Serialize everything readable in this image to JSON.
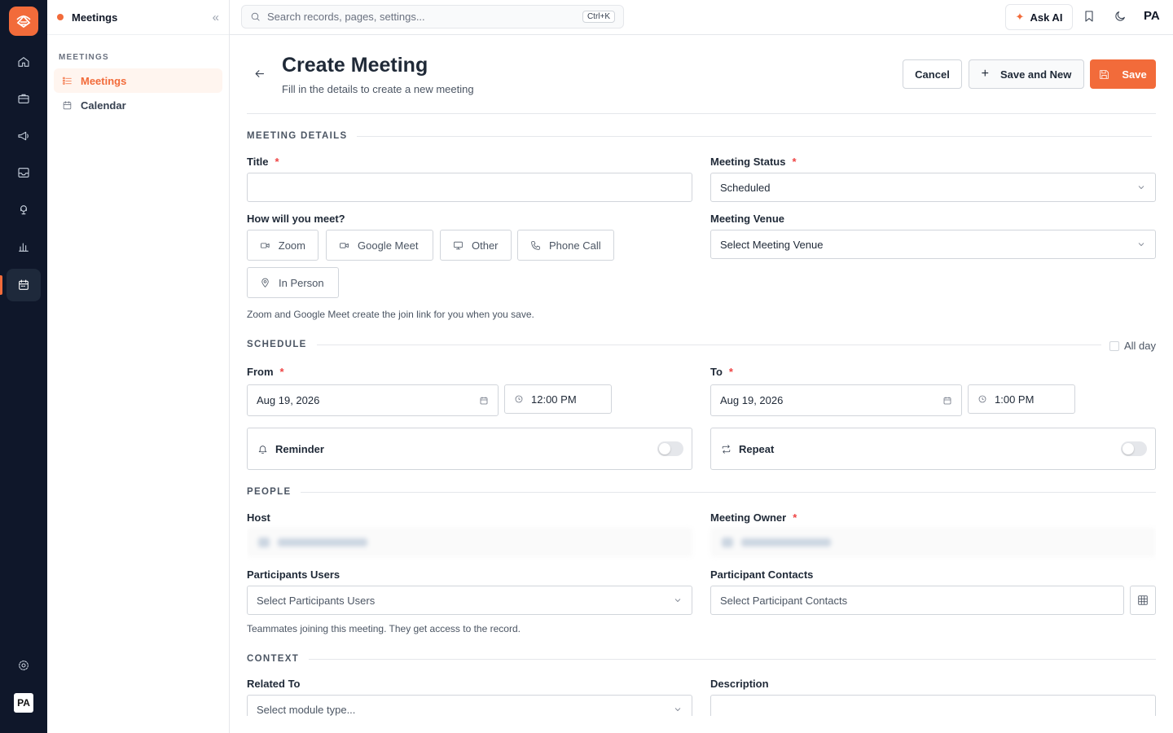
{
  "app": {
    "module": "Meetings"
  },
  "colors": {
    "accent": "#f26b3a",
    "rail": "#0f172a",
    "required": "#ef4444"
  },
  "rail": {
    "icons": [
      "home-icon",
      "briefcase-icon",
      "megaphone-icon",
      "inbox-icon",
      "headset-icon",
      "chart-icon",
      "calendar-icon"
    ],
    "active": "calendar-icon",
    "avatar": "PA"
  },
  "sidebar": {
    "title": "Meetings",
    "section": "MEETINGS",
    "items": [
      {
        "label": "Meetings",
        "icon": "list-icon",
        "active": true
      },
      {
        "label": "Calendar",
        "icon": "calendar-icon",
        "active": false
      }
    ]
  },
  "topbar": {
    "search_placeholder": "Search records, pages, settings...",
    "shortcut": "Ctrl+K",
    "ask_ai": "Ask AI",
    "avatar": "PA"
  },
  "header": {
    "title": "Create Meeting",
    "subtitle": "Fill in the details to create a new meeting",
    "cancel": "Cancel",
    "save_and_new": "Save and New",
    "save": "Save"
  },
  "meeting_details": {
    "section": "MEETING DETAILS",
    "title_label": "Title",
    "title_value": "",
    "status_label": "Meeting Status",
    "status_value": "Scheduled",
    "how_label": "How will you meet?",
    "modes": [
      "Zoom",
      "Google Meet",
      "Other",
      "Phone Call",
      "In Person"
    ],
    "venue_label": "Meeting Venue",
    "venue_placeholder": "Select Meeting Venue",
    "hint": "Zoom and Google Meet create the join link for you when you save."
  },
  "schedule": {
    "section": "SCHEDULE",
    "all_day": "All day",
    "from_label": "From",
    "from_date": "Aug 19, 2026",
    "from_time": "12:00 PM",
    "to_label": "To",
    "to_date": "Aug 19, 2026",
    "to_time": "1:00 PM",
    "reminder": "Reminder",
    "repeat": "Repeat"
  },
  "people": {
    "section": "PEOPLE",
    "host_label": "Host",
    "owner_label": "Meeting Owner",
    "participants_users_label": "Participants Users",
    "participants_users_placeholder": "Select Participants Users",
    "participant_contacts_label": "Participant Contacts",
    "participant_contacts_placeholder": "Select Participant Contacts",
    "hint": "Teammates joining this meeting. They get access to the record."
  },
  "context": {
    "section": "CONTEXT",
    "related_label": "Related To",
    "related_placeholder": "Select module type...",
    "description_label": "Description"
  }
}
